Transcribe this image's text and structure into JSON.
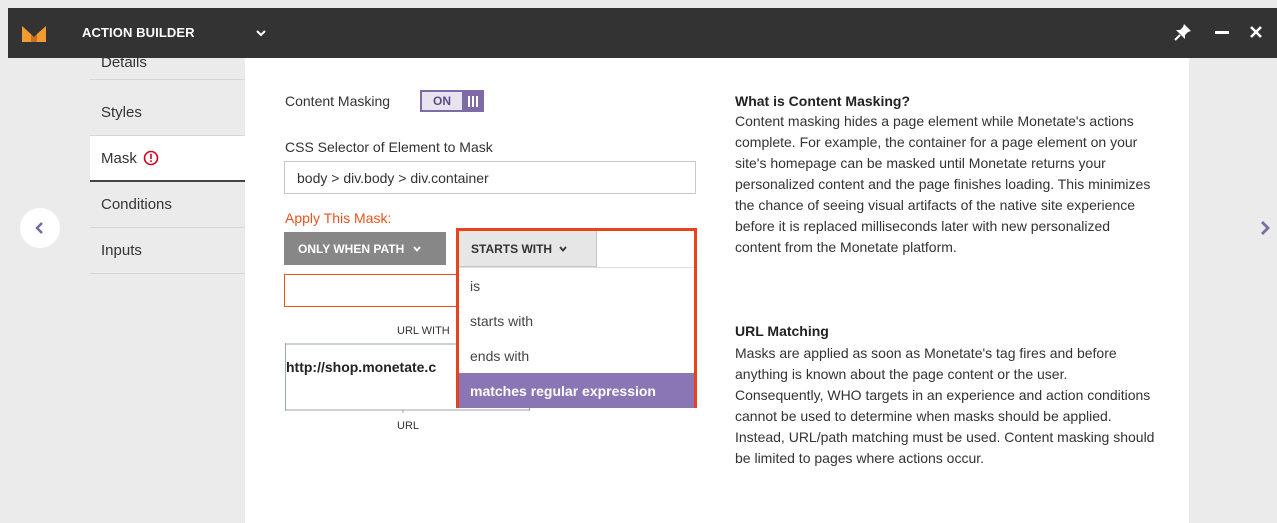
{
  "header": {
    "app_title": "ACTION BUILDER",
    "logo_icon": "monetate-logo-icon",
    "menu_icon": "chevron-down-icon",
    "pin_icon": "pin-icon",
    "minimize_icon": "minimize-icon",
    "close_icon": "close-icon"
  },
  "sidebar": {
    "items": [
      {
        "label": "Details"
      },
      {
        "label": "Styles"
      },
      {
        "label": "Mask",
        "warning_icon": "alert-circle-icon",
        "active": true
      },
      {
        "label": "Conditions"
      },
      {
        "label": "Inputs"
      }
    ]
  },
  "navigation": {
    "back_icon": "chevron-left-icon",
    "next_icon": "chevron-right-icon"
  },
  "form": {
    "content_masking_label": "Content Masking",
    "toggle_label": "ON",
    "css_selector_label": "CSS Selector of Element to Mask",
    "css_selector_value": "body > div.body > div.container",
    "apply_mask_label": "Apply This Mask:",
    "path_button_label": "ONLY WHEN PATH",
    "value_input": "",
    "diagram": {
      "top_label": "URL WITH",
      "url_text": "http://shop.monetate.c",
      "bottom_label": "URL"
    }
  },
  "dropdown": {
    "selected_label": "STARTS WITH",
    "options": [
      {
        "label": "is"
      },
      {
        "label": "starts with"
      },
      {
        "label": "ends with"
      },
      {
        "label": "matches regular expression",
        "highlighted": true
      }
    ]
  },
  "help": {
    "content_masking_title": "What is Content Masking?",
    "content_masking_body": "Content masking hides a page element while Monetate's actions complete. For example, the container for a page element on your site's homepage can be masked until Monetate returns your personalized content and the page finishes loading. This minimizes the chance of seeing visual artifacts of the native site experience before it is replaced milliseconds later with new personalized content from the Monetate platform.",
    "url_matching_title": "URL Matching",
    "url_matching_body": "Masks are applied as soon as Monetate's tag fires and before anything is known about the page content or the user. Consequently, WHO targets in an experience and action conditions cannot be used to determine when masks should be applied. Instead, URL/path matching must be used. Content masking should be limited to pages where actions occur."
  },
  "colors": {
    "header_bg": "#333333",
    "accent_purple": "#7d6aa6",
    "highlight_purple": "#8a76b5",
    "alert_orange": "#e8531c",
    "dropdown_border": "#e8431c"
  }
}
